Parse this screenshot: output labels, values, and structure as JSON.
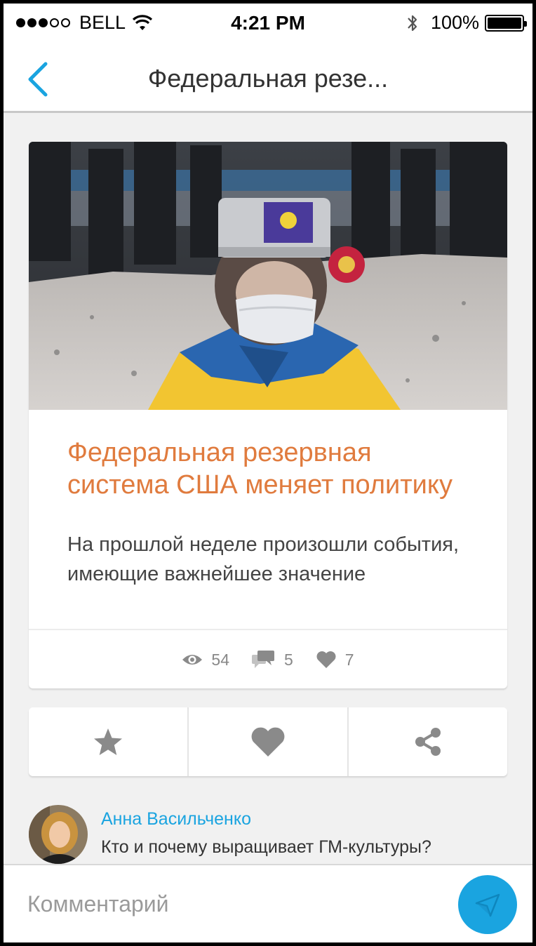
{
  "status_bar": {
    "carrier": "BELL",
    "time": "4:21 PM",
    "battery": "100%",
    "signal_dots_filled": 3,
    "signal_dots_total": 5
  },
  "nav": {
    "back_icon": "chevron-left-icon",
    "title": "Федеральная резе..."
  },
  "article": {
    "title": "Федеральная резервная система США меняет политику",
    "lead": "На прошлой неделе произошли события, имеющие важнейшее значение",
    "stats": {
      "views": "54",
      "comments": "5",
      "likes": "7"
    }
  },
  "actions": [
    {
      "icon": "star-icon",
      "name": "favorite"
    },
    {
      "icon": "heart-icon",
      "name": "like"
    },
    {
      "icon": "share-icon",
      "name": "share"
    }
  ],
  "comment": {
    "author": "Анна Васильченко",
    "text": "Кто и почему выращивает ГМ-культуры?"
  },
  "input": {
    "placeholder": "Комментарий"
  },
  "colors": {
    "accent": "#1aa4e0",
    "title": "#e07b3e",
    "background": "#f1f1f1"
  }
}
